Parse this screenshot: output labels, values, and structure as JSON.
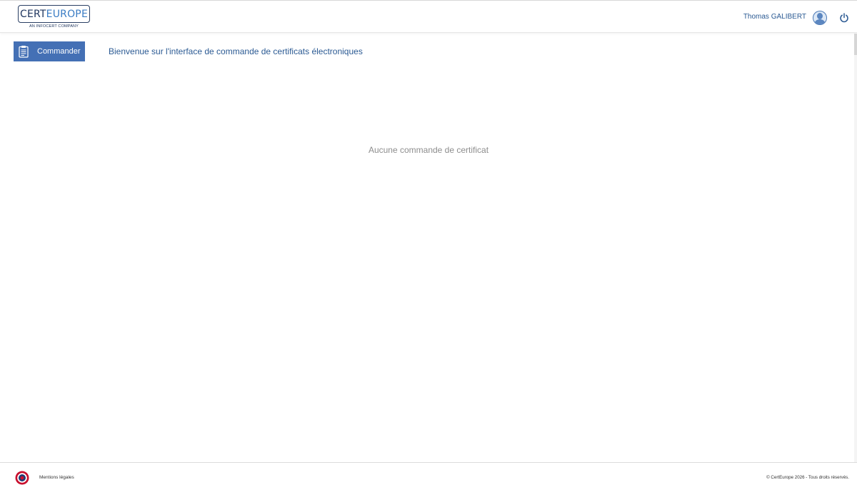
{
  "header": {
    "logo": {
      "main_dark": "CERT",
      "main_light": "EUROPE",
      "tagline": "AN INFOCERT COMPANY"
    },
    "user_name": "Thomas GALIBERT",
    "avatar_icon": "user-avatar-icon",
    "logout_icon": "power-icon"
  },
  "actions": {
    "order_button_label": "Commander",
    "order_button_icon": "clipboard-icon"
  },
  "main": {
    "welcome_text": "Bienvenue sur l'interface de commande de certificats électroniques",
    "empty_message": "Aucune commande de certificat"
  },
  "footer": {
    "legal_link": "Mentions légales",
    "copyright": "© CertEurope 2026 - Tous droits réservés.",
    "badge_icon": "french-roundel-icon"
  },
  "colors": {
    "primary": "#4470b5",
    "text_blue": "#2b5a93",
    "muted": "#8d8d8d",
    "roundel_red": "#c8102e",
    "roundel_blue": "#1f3a73"
  }
}
